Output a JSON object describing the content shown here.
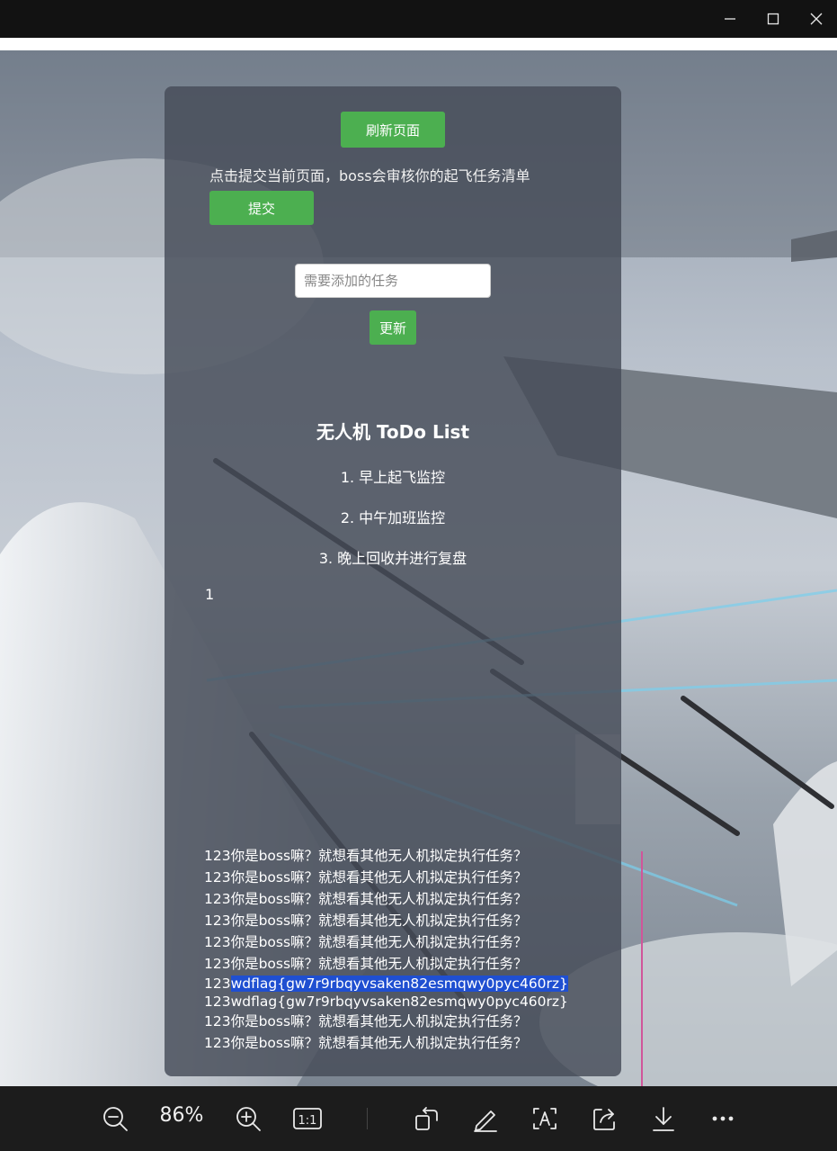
{
  "panel": {
    "refresh_label": "刷新页面",
    "hint": "点击提交当前页面，boss会审核你的起飞任务清单",
    "submit_label": "提交",
    "task_placeholder": "需要添加的任务",
    "update_label": "更新",
    "list_title": "无人机 ToDo List",
    "items": [
      "1. 早上起飞监控",
      "2. 中午加班监控",
      "3. 晚上回收并进行复盘"
    ],
    "counter": "1",
    "log_lines": [
      "123你是boss嘛？就想看其他无人机拟定执行任务？",
      "123你是boss嘛？就想看其他无人机拟定执行任务？",
      "123你是boss嘛？就想看其他无人机拟定执行任务？",
      "123你是boss嘛？就想看其他无人机拟定执行任务？",
      "123你是boss嘛？就想看其他无人机拟定执行任务？",
      "123你是boss嘛？就想看其他无人机拟定执行任务？"
    ],
    "flag_prefix": "123",
    "flag_selected": "wdflag{gw7r9rbqyvsaken82esmqwy0pyc460rz}",
    "flag_line": "123wdflag{gw7r9rbqyvsaken82esmqwy0pyc460rz}",
    "tail_lines": [
      "123你是boss嘛？就想看其他无人机拟定执行任务？",
      "123你是boss嘛？就想看其他无人机拟定执行任务？"
    ]
  },
  "toolbar": {
    "zoom": "86%",
    "icons": [
      "zoom-out-icon",
      "zoom-in-icon",
      "actual-size-icon",
      "rotate-icon",
      "edit-icon",
      "text-select-icon",
      "share-icon",
      "download-icon",
      "more-icon"
    ],
    "actual_size_label": "1:1"
  },
  "colors": {
    "accent_green": "#4caf50",
    "selection_blue": "#1f4fd1"
  }
}
